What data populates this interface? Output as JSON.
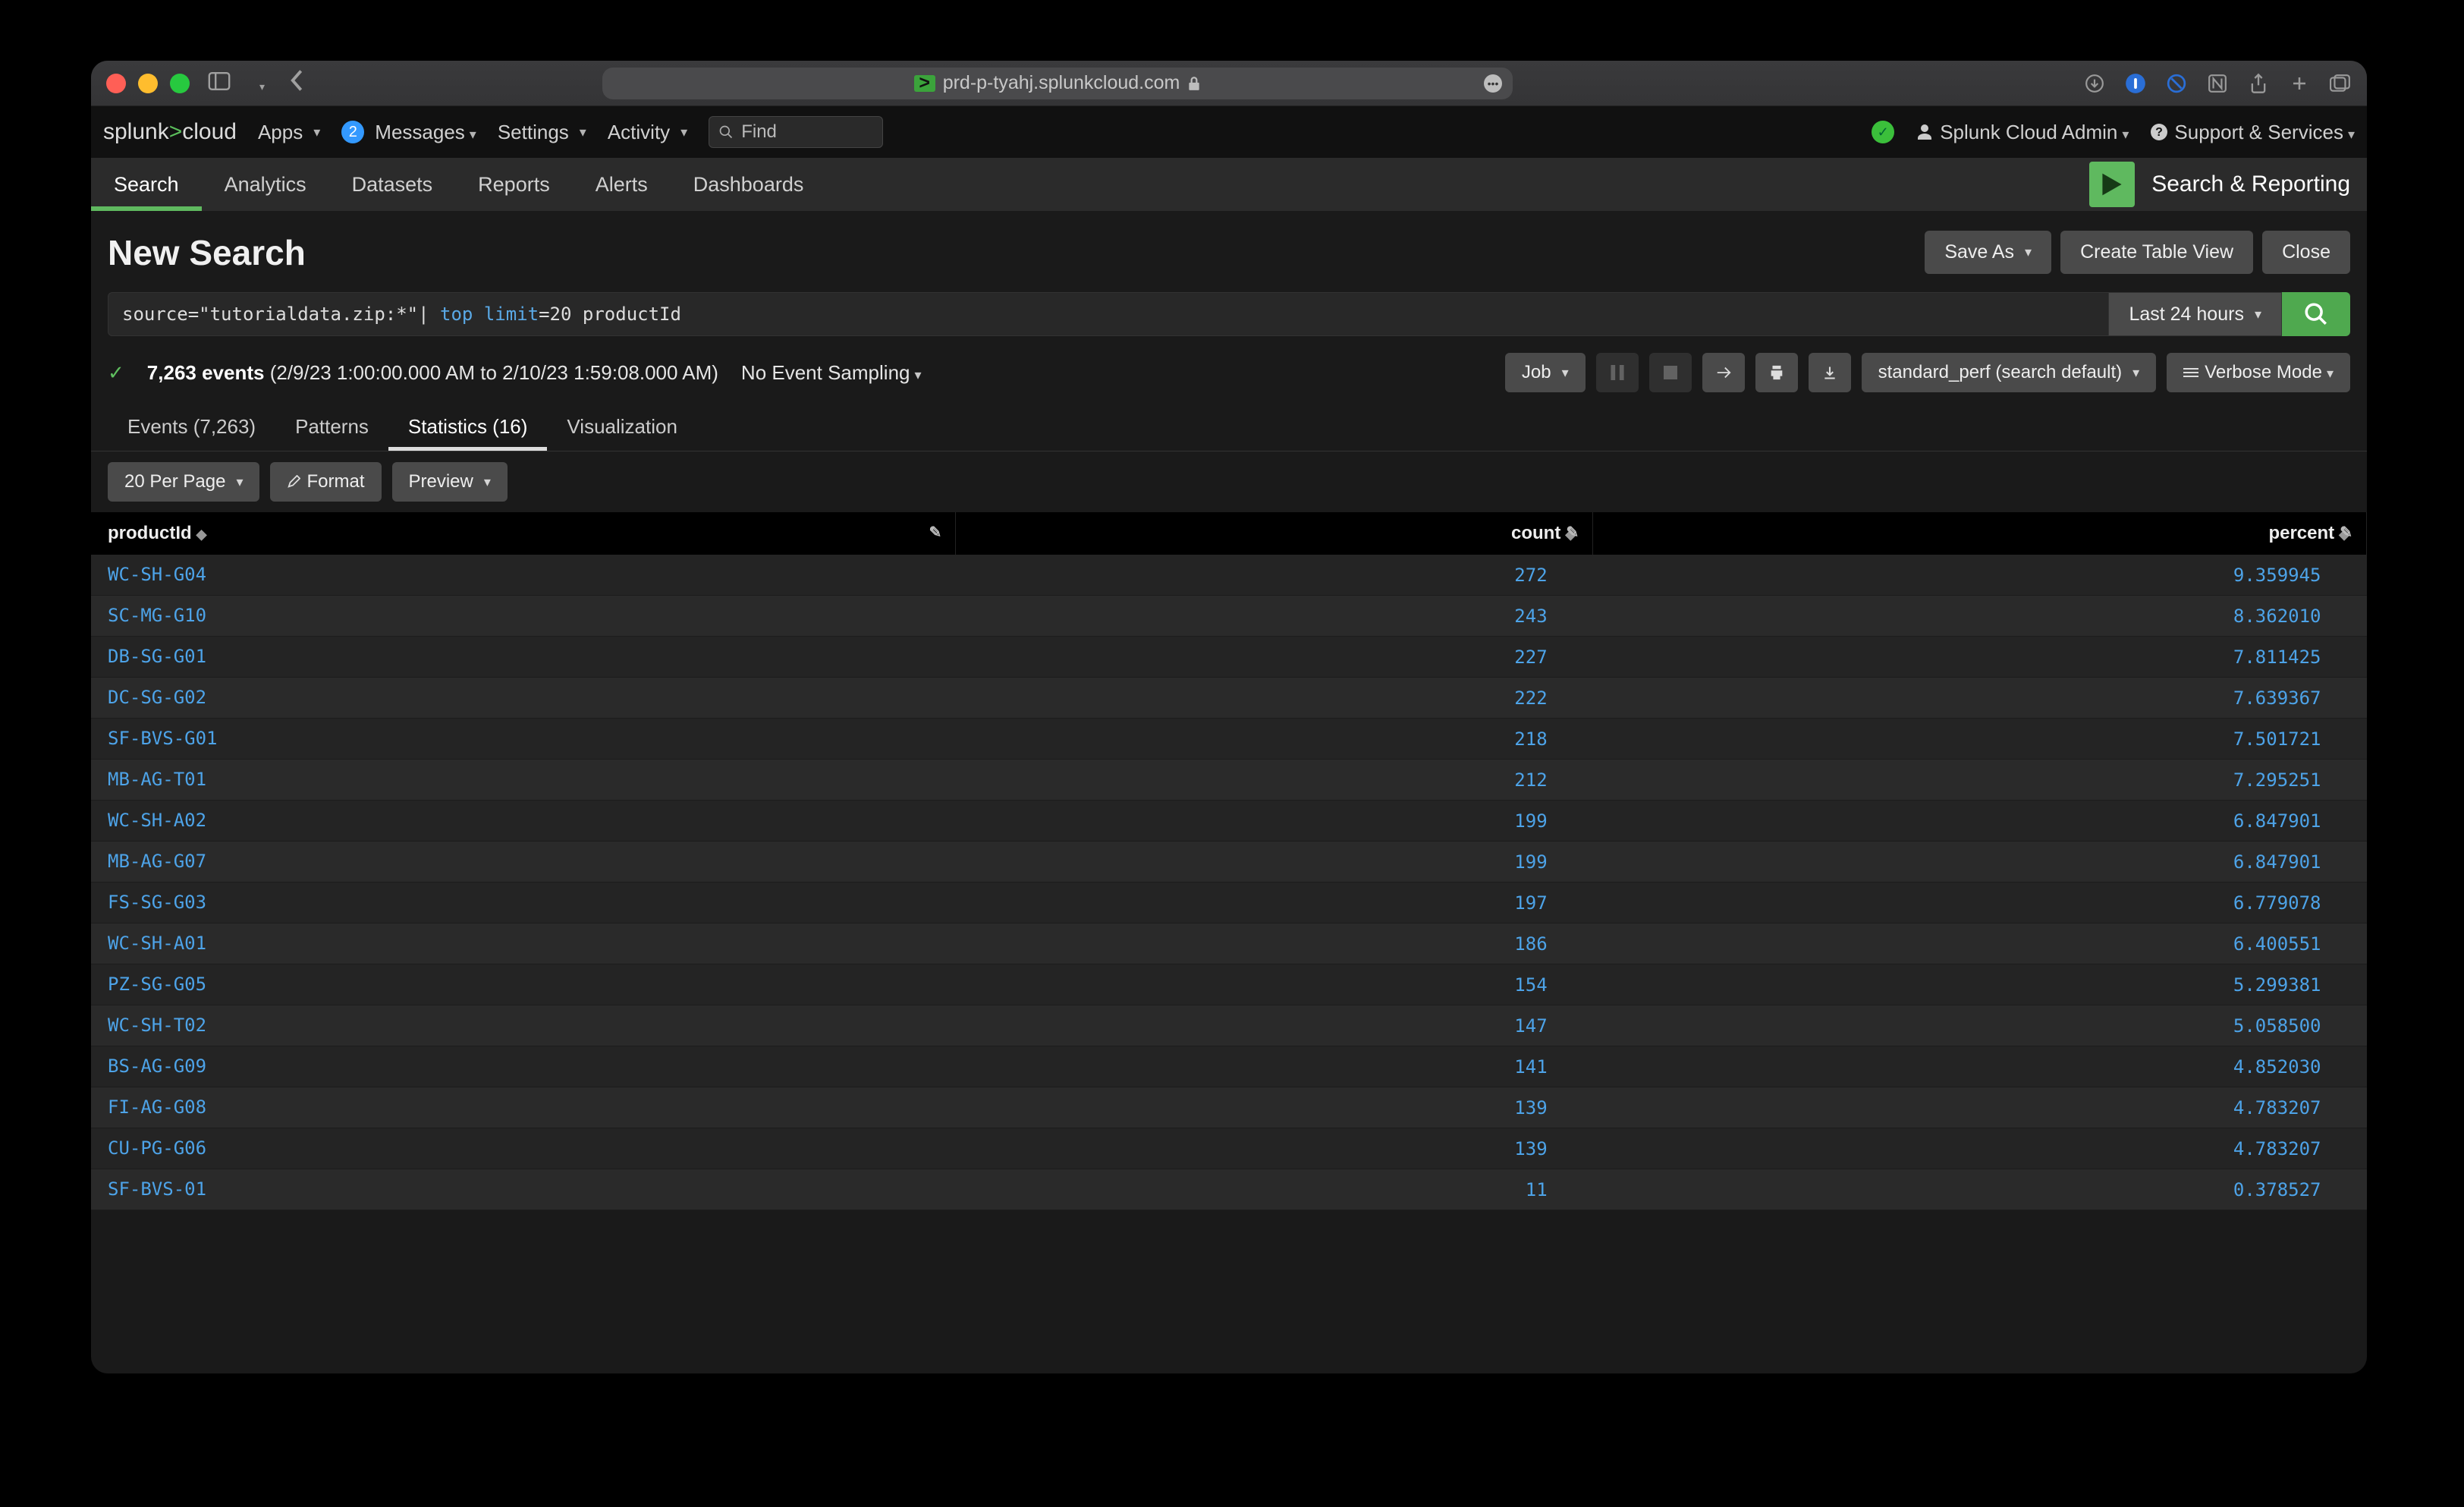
{
  "browser": {
    "url": "prd-p-tyahj.splunkcloud.com",
    "secure_icon": "lock-icon"
  },
  "globalnav": {
    "logo": "splunk>cloud",
    "menu": [
      "Apps",
      "Messages",
      "Settings",
      "Activity"
    ],
    "messages_badge": "2",
    "find_placeholder": "Find",
    "user_label": "Splunk Cloud Admin",
    "support_label": "Support & Services"
  },
  "appbar": {
    "tabs": [
      "Search",
      "Analytics",
      "Datasets",
      "Reports",
      "Alerts",
      "Dashboards"
    ],
    "active_index": 0,
    "brand": "Search & Reporting"
  },
  "page": {
    "title": "New Search",
    "save_as": "Save As",
    "create_table": "Create Table View",
    "close": "Close"
  },
  "search": {
    "query_prefix": "source=\"tutorialdata.zip:*\"| ",
    "query_kw1": "top",
    "query_kw2": "limit",
    "query_suffix": "=20 productId",
    "time": "Last 24 hours"
  },
  "status": {
    "count": "7,263 events",
    "range": "(2/9/23 1:00:00.000 AM to 2/10/23 1:59:08.000 AM)",
    "sampling": "No Event Sampling",
    "job": "Job",
    "search_perf": "standard_perf (search default)",
    "mode": "Verbose Mode"
  },
  "result_tabs": {
    "events": "Events (7,263)",
    "patterns": "Patterns",
    "statistics": "Statistics (16)",
    "visualization": "Visualization"
  },
  "toolbar": {
    "per_page": "20 Per Page",
    "format": "Format",
    "preview": "Preview"
  },
  "table": {
    "columns": [
      "productId",
      "count",
      "percent"
    ],
    "rows": [
      {
        "productId": "WC-SH-G04",
        "count": "272",
        "percent": "9.359945"
      },
      {
        "productId": "SC-MG-G10",
        "count": "243",
        "percent": "8.362010"
      },
      {
        "productId": "DB-SG-G01",
        "count": "227",
        "percent": "7.811425"
      },
      {
        "productId": "DC-SG-G02",
        "count": "222",
        "percent": "7.639367"
      },
      {
        "productId": "SF-BVS-G01",
        "count": "218",
        "percent": "7.501721"
      },
      {
        "productId": "MB-AG-T01",
        "count": "212",
        "percent": "7.295251"
      },
      {
        "productId": "WC-SH-A02",
        "count": "199",
        "percent": "6.847901"
      },
      {
        "productId": "MB-AG-G07",
        "count": "199",
        "percent": "6.847901"
      },
      {
        "productId": "FS-SG-G03",
        "count": "197",
        "percent": "6.779078"
      },
      {
        "productId": "WC-SH-A01",
        "count": "186",
        "percent": "6.400551"
      },
      {
        "productId": "PZ-SG-G05",
        "count": "154",
        "percent": "5.299381"
      },
      {
        "productId": "WC-SH-T02",
        "count": "147",
        "percent": "5.058500"
      },
      {
        "productId": "BS-AG-G09",
        "count": "141",
        "percent": "4.852030"
      },
      {
        "productId": "FI-AG-G08",
        "count": "139",
        "percent": "4.783207"
      },
      {
        "productId": "CU-PG-G06",
        "count": "139",
        "percent": "4.783207"
      },
      {
        "productId": "SF-BVS-01",
        "count": "11",
        "percent": "0.378527"
      }
    ]
  }
}
